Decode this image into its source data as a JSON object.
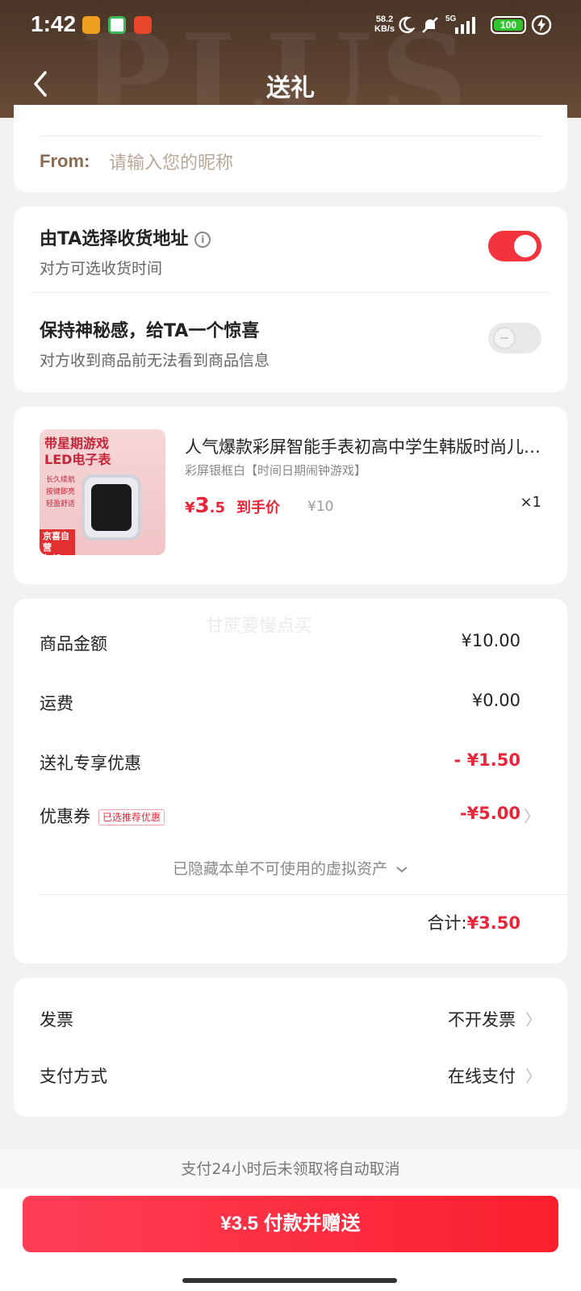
{
  "status_bar": {
    "time": "1:42",
    "net_speed_value": "58.2",
    "net_speed_unit": "KB/s",
    "network": "5G",
    "battery": "100"
  },
  "navbar": {
    "title": "送礼",
    "back_icon": "chevron-left-icon",
    "watermark": "PLUS"
  },
  "from_section": {
    "label": "From:",
    "placeholder": "请输入您的昵称"
  },
  "options": [
    {
      "title": "由TA选择收货地址",
      "subtitle": "对方可选收货时间",
      "enabled": true,
      "info_icon": "info-icon"
    },
    {
      "title": "保持神秘感，给TA一个惊喜",
      "subtitle": "对方收到商品前无法看到商品信息",
      "enabled": false
    }
  ],
  "product": {
    "image_title": "带星期游戏\nLED电子表",
    "image_features": [
      "长久续航",
      "按键即亮",
      "轻盈舒适"
    ],
    "image_badge": "京喜自营\n包邮",
    "title": "人气爆款彩屏智能手表初高中学生韩版时尚儿童电子表",
    "spec": "彩屏银框白【时间日期闹钟游戏】",
    "price_currency": "¥",
    "price_int": "3",
    "price_dec": ".5",
    "price_label": "到手价",
    "original_price": "¥10",
    "quantity": "×1"
  },
  "costs": {
    "watermark": "甘蔗要慢点买",
    "rows": [
      {
        "label": "商品金额",
        "value": "¥10.00"
      },
      {
        "label": "运费",
        "value": "¥0.00"
      },
      {
        "label": "送礼专享优惠",
        "value": "- ¥1.50"
      },
      {
        "label": "优惠券",
        "tag": "已选推荐优惠",
        "value": "-¥5.00"
      }
    ],
    "hidden_assets": "已隐藏本单不可使用的虚拟资产",
    "total_label": "合计:",
    "total_value": "¥3.50"
  },
  "payment": {
    "rows": [
      {
        "label": "发票",
        "value": "不开发票"
      },
      {
        "label": "支付方式",
        "value": "在线支付"
      }
    ]
  },
  "footer": {
    "notice": "支付24小时后未领取将自动取消",
    "pay_button": "¥3.5 付款并赠送"
  },
  "colors": {
    "accent_red": "#e8263a",
    "header_brown": "#5a4030",
    "toggle_on": "#f5333f"
  }
}
